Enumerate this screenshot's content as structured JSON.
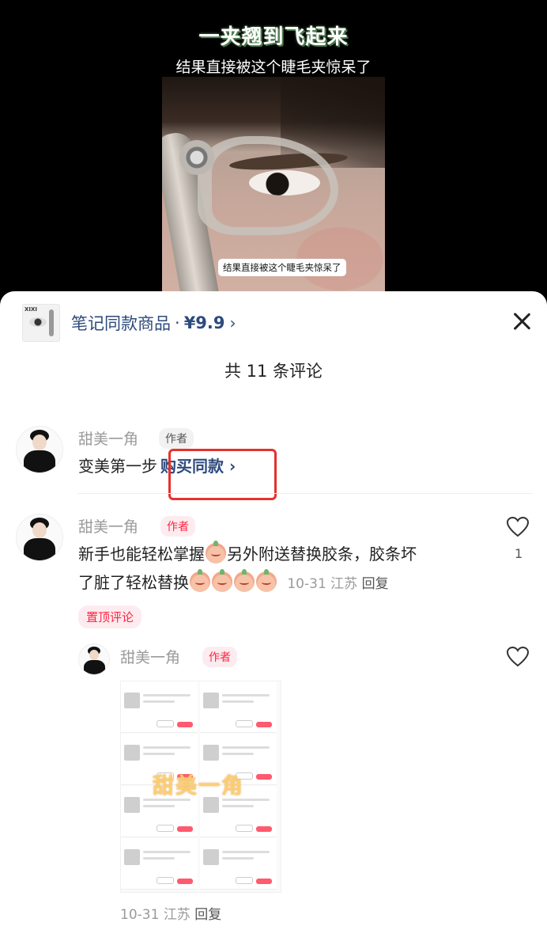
{
  "video": {
    "title": "一夹翘到飞起来",
    "caption": "结果直接被这个睫毛夹惊呆了",
    "subtitle_pill": "结果直接被这个睫毛夹惊呆了"
  },
  "product": {
    "label": "笔记同款商品",
    "separator": "·",
    "price": "¥9.9",
    "chevron": "›",
    "thumb_label": "XIXI"
  },
  "comments_header": {
    "count_text": "共 11 条评论"
  },
  "comments": [
    {
      "username": "甜美一角",
      "author_tag": "作者",
      "text_prefix": "变美第一步",
      "buy_link": "购买同款",
      "buy_chevron": "›"
    },
    {
      "username": "甜美一角",
      "author_tag": "作者",
      "text_line1_a": "新手也能轻松掌握",
      "text_line1_b": "另外附送替换胶条，胶条坏",
      "text_line2": "了脏了轻松替换",
      "date": "10-31",
      "location": "江苏",
      "reply_label": "回复",
      "like_count": "1",
      "pin_label": "置顶评论"
    }
  ],
  "reply": {
    "username": "甜美一角",
    "author_tag": "作者",
    "image_watermark": "甜美一角",
    "date": "10-31",
    "location": "江苏",
    "reply_label": "回复"
  },
  "colors": {
    "accent_red": "#ff2442",
    "link_blue": "#2c4a7c",
    "highlight_box": "#e5322d"
  }
}
